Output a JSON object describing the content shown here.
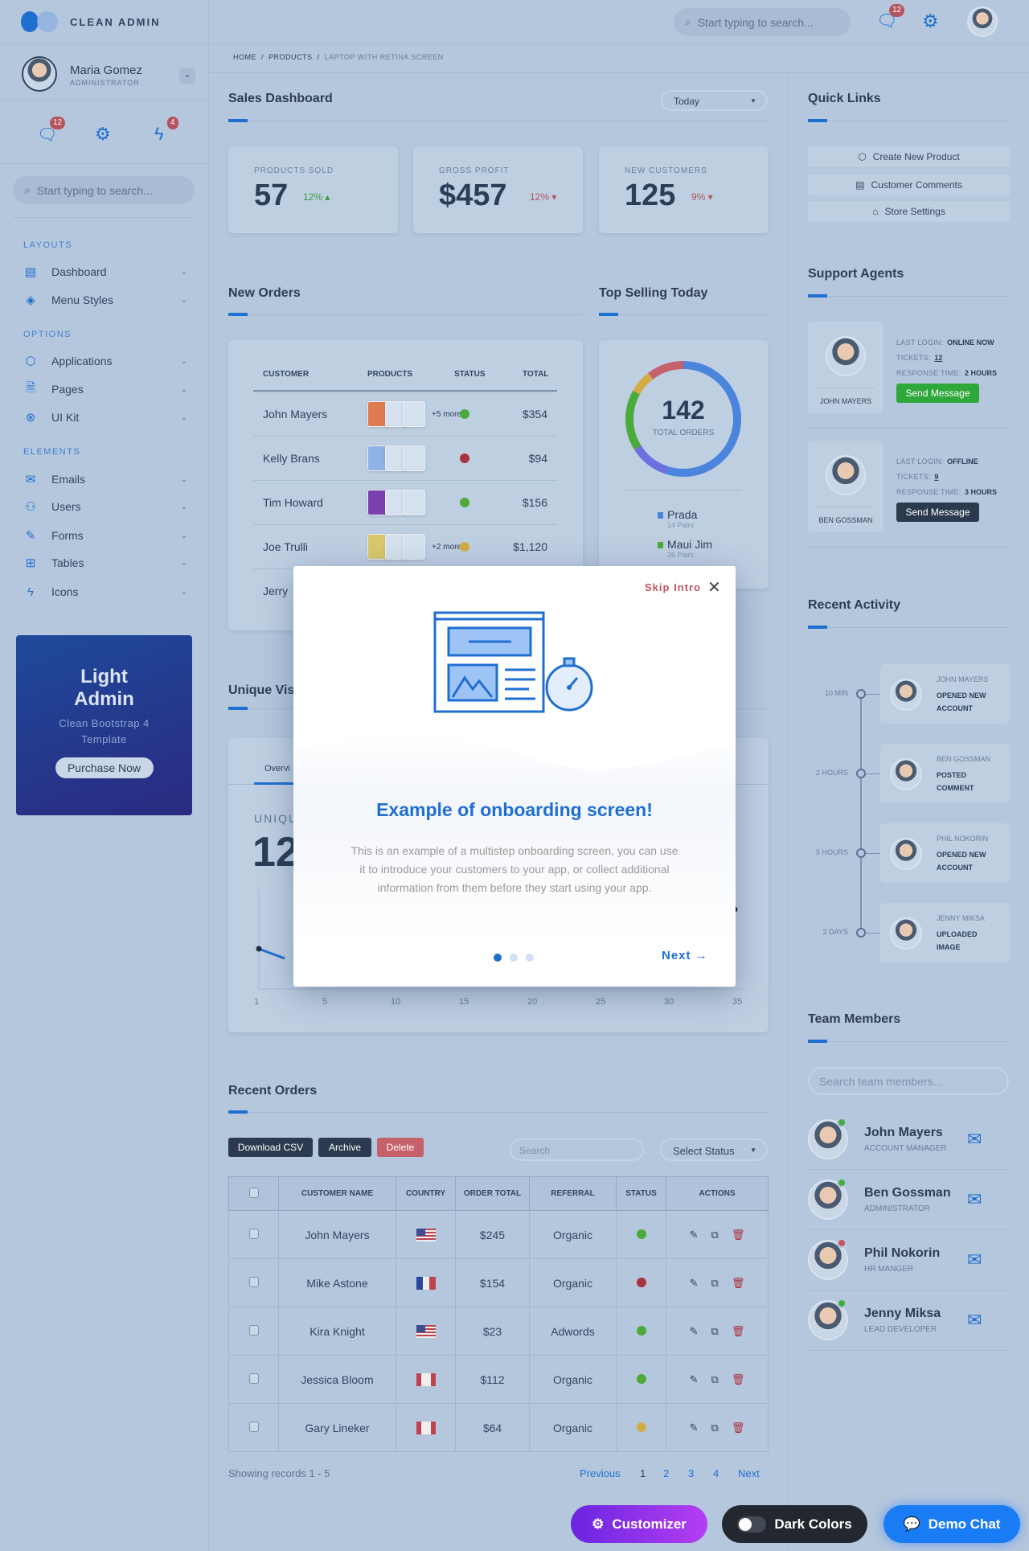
{
  "app": {
    "name": "CLEAN ADMIN"
  },
  "topbar": {
    "search_placeholder": "Start typing to search...",
    "messages_count": "12"
  },
  "user": {
    "name": "Maria Gomez",
    "role": "ADMINISTRATOR"
  },
  "sidebar": {
    "messages_count": "12",
    "alerts_count": "4",
    "search_placeholder": "Start typing to search...",
    "sections": [
      {
        "label": "LAYOUTS",
        "items": [
          "Dashboard",
          "Menu Styles"
        ]
      },
      {
        "label": "OPTIONS",
        "items": [
          "Applications",
          "Pages",
          "UI Kit"
        ]
      },
      {
        "label": "ELEMENTS",
        "items": [
          "Emails",
          "Users",
          "Forms",
          "Tables",
          "Icons"
        ]
      }
    ],
    "promo": {
      "title1": "Light",
      "title2": "Admin",
      "subtitle": "Clean Bootstrap 4 Template",
      "button": "Purchase Now"
    }
  },
  "breadcrumb": [
    "HOME",
    "PRODUCTS",
    "LAPTOP WITH RETINA SCREEN"
  ],
  "sales": {
    "title": "Sales Dashboard",
    "period": "Today",
    "stats": [
      {
        "label": "PRODUCTS SOLD",
        "value": "57",
        "change": "12%",
        "dir": "up"
      },
      {
        "label": "GROSS PROFIT",
        "value": "$457",
        "change": "12%",
        "dir": "down"
      },
      {
        "label": "NEW CUSTOMERS",
        "value": "125",
        "change": "9%",
        "dir": "down"
      }
    ]
  },
  "new_orders": {
    "title": "New Orders",
    "headers": [
      "CUSTOMER",
      "PRODUCTS",
      "STATUS",
      "TOTAL"
    ],
    "rows": [
      {
        "customer": "John Mayers",
        "more": "+5 more",
        "status": "#4caa3a",
        "total": "$354"
      },
      {
        "customer": "Kelly Brans",
        "more": "",
        "status": "#a8323e",
        "total": "$94"
      },
      {
        "customer": "Tim Howard",
        "more": "",
        "status": "#4caa3a",
        "total": "$156"
      },
      {
        "customer": "Joe Trulli",
        "more": "+2 more",
        "status": "#d4ac44",
        "total": "$1,120"
      },
      {
        "customer": "Jerry",
        "more": "",
        "status": "",
        "total": ""
      }
    ]
  },
  "top_selling": {
    "title": "Top Selling Today",
    "total": "142",
    "total_label": "TOTAL ORDERS",
    "legend": [
      {
        "name": "Prada",
        "sub": "14 Pairs",
        "color": "#4a84dc"
      },
      {
        "name": "Maui Jim",
        "sub": "26 Pairs",
        "color": "#4caa3a"
      }
    ]
  },
  "unique": {
    "title": "Unique Vis",
    "tab": "Overvi",
    "label": "UNIQU",
    "value": "12",
    "x_ticks": [
      "1",
      "5",
      "10",
      "15",
      "20",
      "25",
      "30",
      "35"
    ]
  },
  "recent_orders": {
    "title": "Recent Orders",
    "buttons": [
      "Download CSV",
      "Archive",
      "Delete"
    ],
    "search_placeholder": "Search",
    "status_select": "Select Status",
    "headers": [
      "CUSTOMER NAME",
      "COUNTRY",
      "ORDER TOTAL",
      "REFERRAL",
      "STATUS",
      "ACTIONS"
    ],
    "rows": [
      {
        "name": "John Mayers",
        "country": "us",
        "total": "$245",
        "referral": "Organic",
        "status": "#4caa3a"
      },
      {
        "name": "Mike Astone",
        "country": "fr",
        "total": "$154",
        "referral": "Organic",
        "status": "#a8323e"
      },
      {
        "name": "Kira Knight",
        "country": "us",
        "total": "$23",
        "referral": "Adwords",
        "status": "#4caa3a"
      },
      {
        "name": "Jessica Bloom",
        "country": "ca",
        "total": "$112",
        "referral": "Organic",
        "status": "#4caa3a"
      },
      {
        "name": "Gary Lineker",
        "country": "ca",
        "total": "$64",
        "referral": "Organic",
        "status": "#d4ac44"
      }
    ],
    "footer": "Showing records 1 - 5",
    "pagination": [
      "Previous",
      "1",
      "2",
      "3",
      "4",
      "Next"
    ]
  },
  "quick_links": {
    "title": "Quick Links",
    "items": [
      "Create New Product",
      "Customer Comments",
      "Store Settings"
    ]
  },
  "support": {
    "title": "Support Agents",
    "k_login": "LAST LOGIN:",
    "k_tickets": "TICKETS:",
    "k_resp": "RESPONSE TIME:",
    "send": "Send Message",
    "agents": [
      {
        "name": "JOHN MAYERS",
        "login": "ONLINE NOW",
        "tickets": "12",
        "resp": "2 HOURS"
      },
      {
        "name": "BEN GOSSMAN",
        "login": "OFFLINE",
        "tickets": "9",
        "resp": "3 HOURS"
      }
    ]
  },
  "activity": {
    "title": "Recent Activity",
    "items": [
      {
        "time": "10 MIN",
        "name": "JOHN MAYERS",
        "desc": "OPENED NEW ACCOUNT"
      },
      {
        "time": "2 HOURS",
        "name": "BEN GOSSMAN",
        "desc": "POSTED COMMENT"
      },
      {
        "time": "5 HOURS",
        "name": "PHIL NOKORIN",
        "desc": "OPENED NEW ACCOUNT"
      },
      {
        "time": "2 DAYS",
        "name": "JENNY MIKSA",
        "desc": "UPLOADED IMAGE"
      }
    ]
  },
  "team": {
    "title": "Team Members",
    "search_placeholder": "Search team members...",
    "members": [
      {
        "name": "John Mayers",
        "role": "ACCOUNT MANAGER",
        "status": "#3fae3f"
      },
      {
        "name": "Ben Gossman",
        "role": "ADMINISTRATOR",
        "status": "#3fae3f"
      },
      {
        "name": "Phil Nokorin",
        "role": "HR MANGER",
        "status": "#c4545e"
      },
      {
        "name": "Jenny Miksa",
        "role": "LEAD DEVELOPER",
        "status": "#3fae3f"
      }
    ]
  },
  "modal": {
    "skip": "Skip Intro",
    "title": "Example of onboarding screen!",
    "body": "This is an example of a multistep onboarding screen, you can use it to introduce your customers to your app, or collect additional information from them before they start using your app.",
    "next": "Next",
    "step": 1,
    "steps": 3
  },
  "floating": {
    "customizer": "Customizer",
    "dark": "Dark Colors",
    "chat": "Demo Chat"
  }
}
